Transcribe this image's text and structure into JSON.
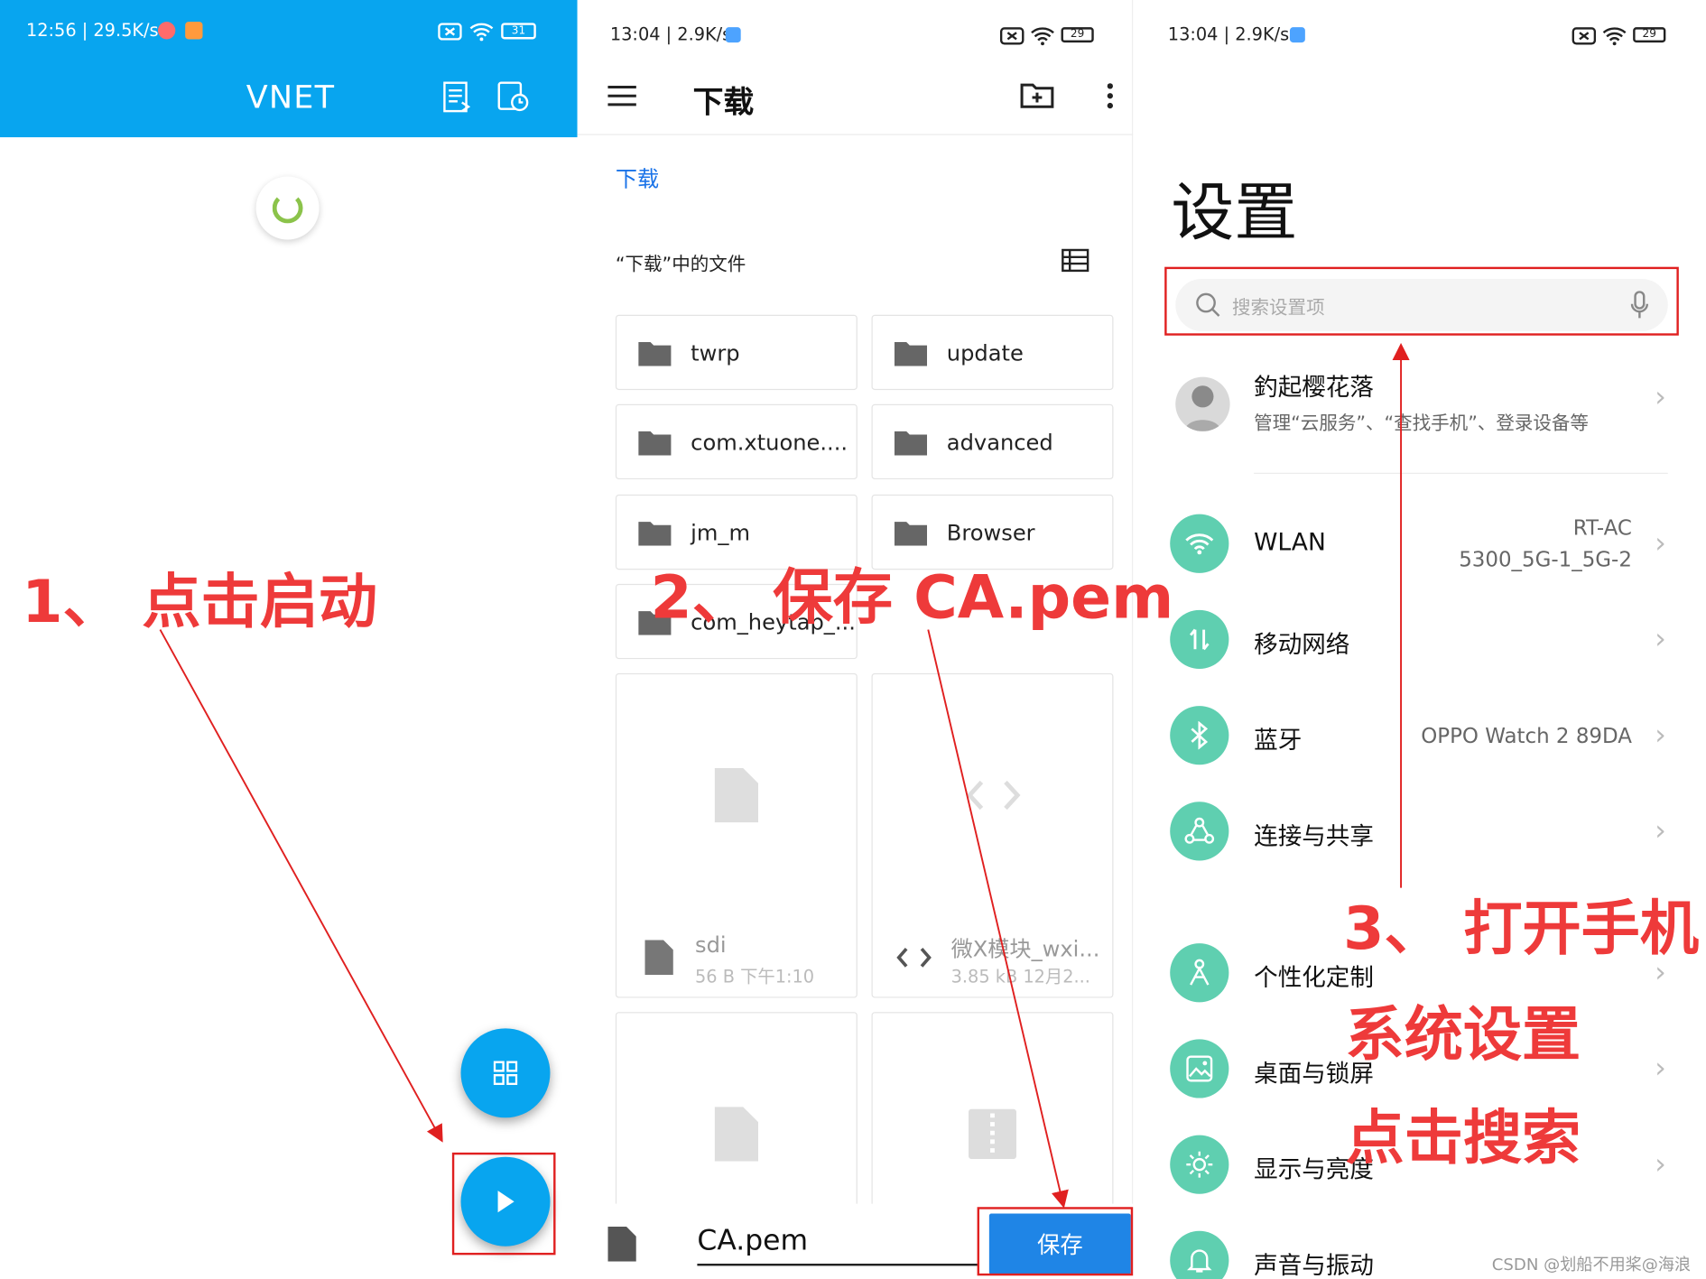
{
  "panel1": {
    "status": "12:56 | 29.5K/s",
    "title": "VNET"
  },
  "panel2": {
    "status": "13:04 | 2.9K/s",
    "title": "下载",
    "breadcrumb": "下载",
    "section": "“下载”中的文件",
    "folders": [
      "twrp",
      "update",
      "com.xtuone....",
      "advanced",
      "jm_m",
      "Browser",
      "com_heytap_..."
    ],
    "files": [
      {
        "name": "sdi",
        "meta": "56 B  下午1:10"
      },
      {
        "name": "微X模块_wxi...",
        "meta": "3.85 kB  12月2..."
      }
    ],
    "filename": "CA.pem",
    "save_label": "保存"
  },
  "panel3": {
    "status": "13:04 | 2.9K/s",
    "title": "设置",
    "search_placeholder": "搜索设置项",
    "account": {
      "name": "釣起樱花落",
      "sub": "管理“云服务”、“查找手机”、登录设备等"
    },
    "rows": [
      {
        "label": "WLAN",
        "value_line1": "RT-AC",
        "value_line2": "5300_5G-1_5G-2",
        "icon": "wifi-icon"
      },
      {
        "label": "移动网络",
        "value_line1": "",
        "value_line2": "",
        "icon": "mobile-data-icon"
      },
      {
        "label": "蓝牙",
        "value_line1": "",
        "value_line2": "OPPO Watch 2 89DA",
        "icon": "bluetooth-icon"
      },
      {
        "label": "连接与共享",
        "value_line1": "",
        "value_line2": "",
        "icon": "share-icon"
      },
      {
        "label": "个性化定制",
        "value_line1": "",
        "value_line2": "",
        "icon": "personalize-icon"
      },
      {
        "label": "桌面与锁屏",
        "value_line1": "",
        "value_line2": "",
        "icon": "wallpaper-icon"
      },
      {
        "label": "显示与亮度",
        "value_line1": "",
        "value_line2": "",
        "icon": "brightness-icon"
      },
      {
        "label": "声音与振动",
        "value_line1": "",
        "value_line2": "",
        "icon": "bell-icon"
      }
    ],
    "battery": "29"
  },
  "battery1": "31",
  "annotations": {
    "step1": "1、 点击启动",
    "step2": "2、 保存 CA.pem",
    "step3_line1": "3、 打开手机",
    "step3_line2": "系统设置",
    "step3_line3": "点击搜索"
  },
  "watermark": "CSDN @划船不用桨@海浪",
  "colors": {
    "vnet_blue": "#08a5ef",
    "teal": "#5fcfb0",
    "annotation_red": "#ee3a3a",
    "link_blue": "#1a73e8"
  }
}
